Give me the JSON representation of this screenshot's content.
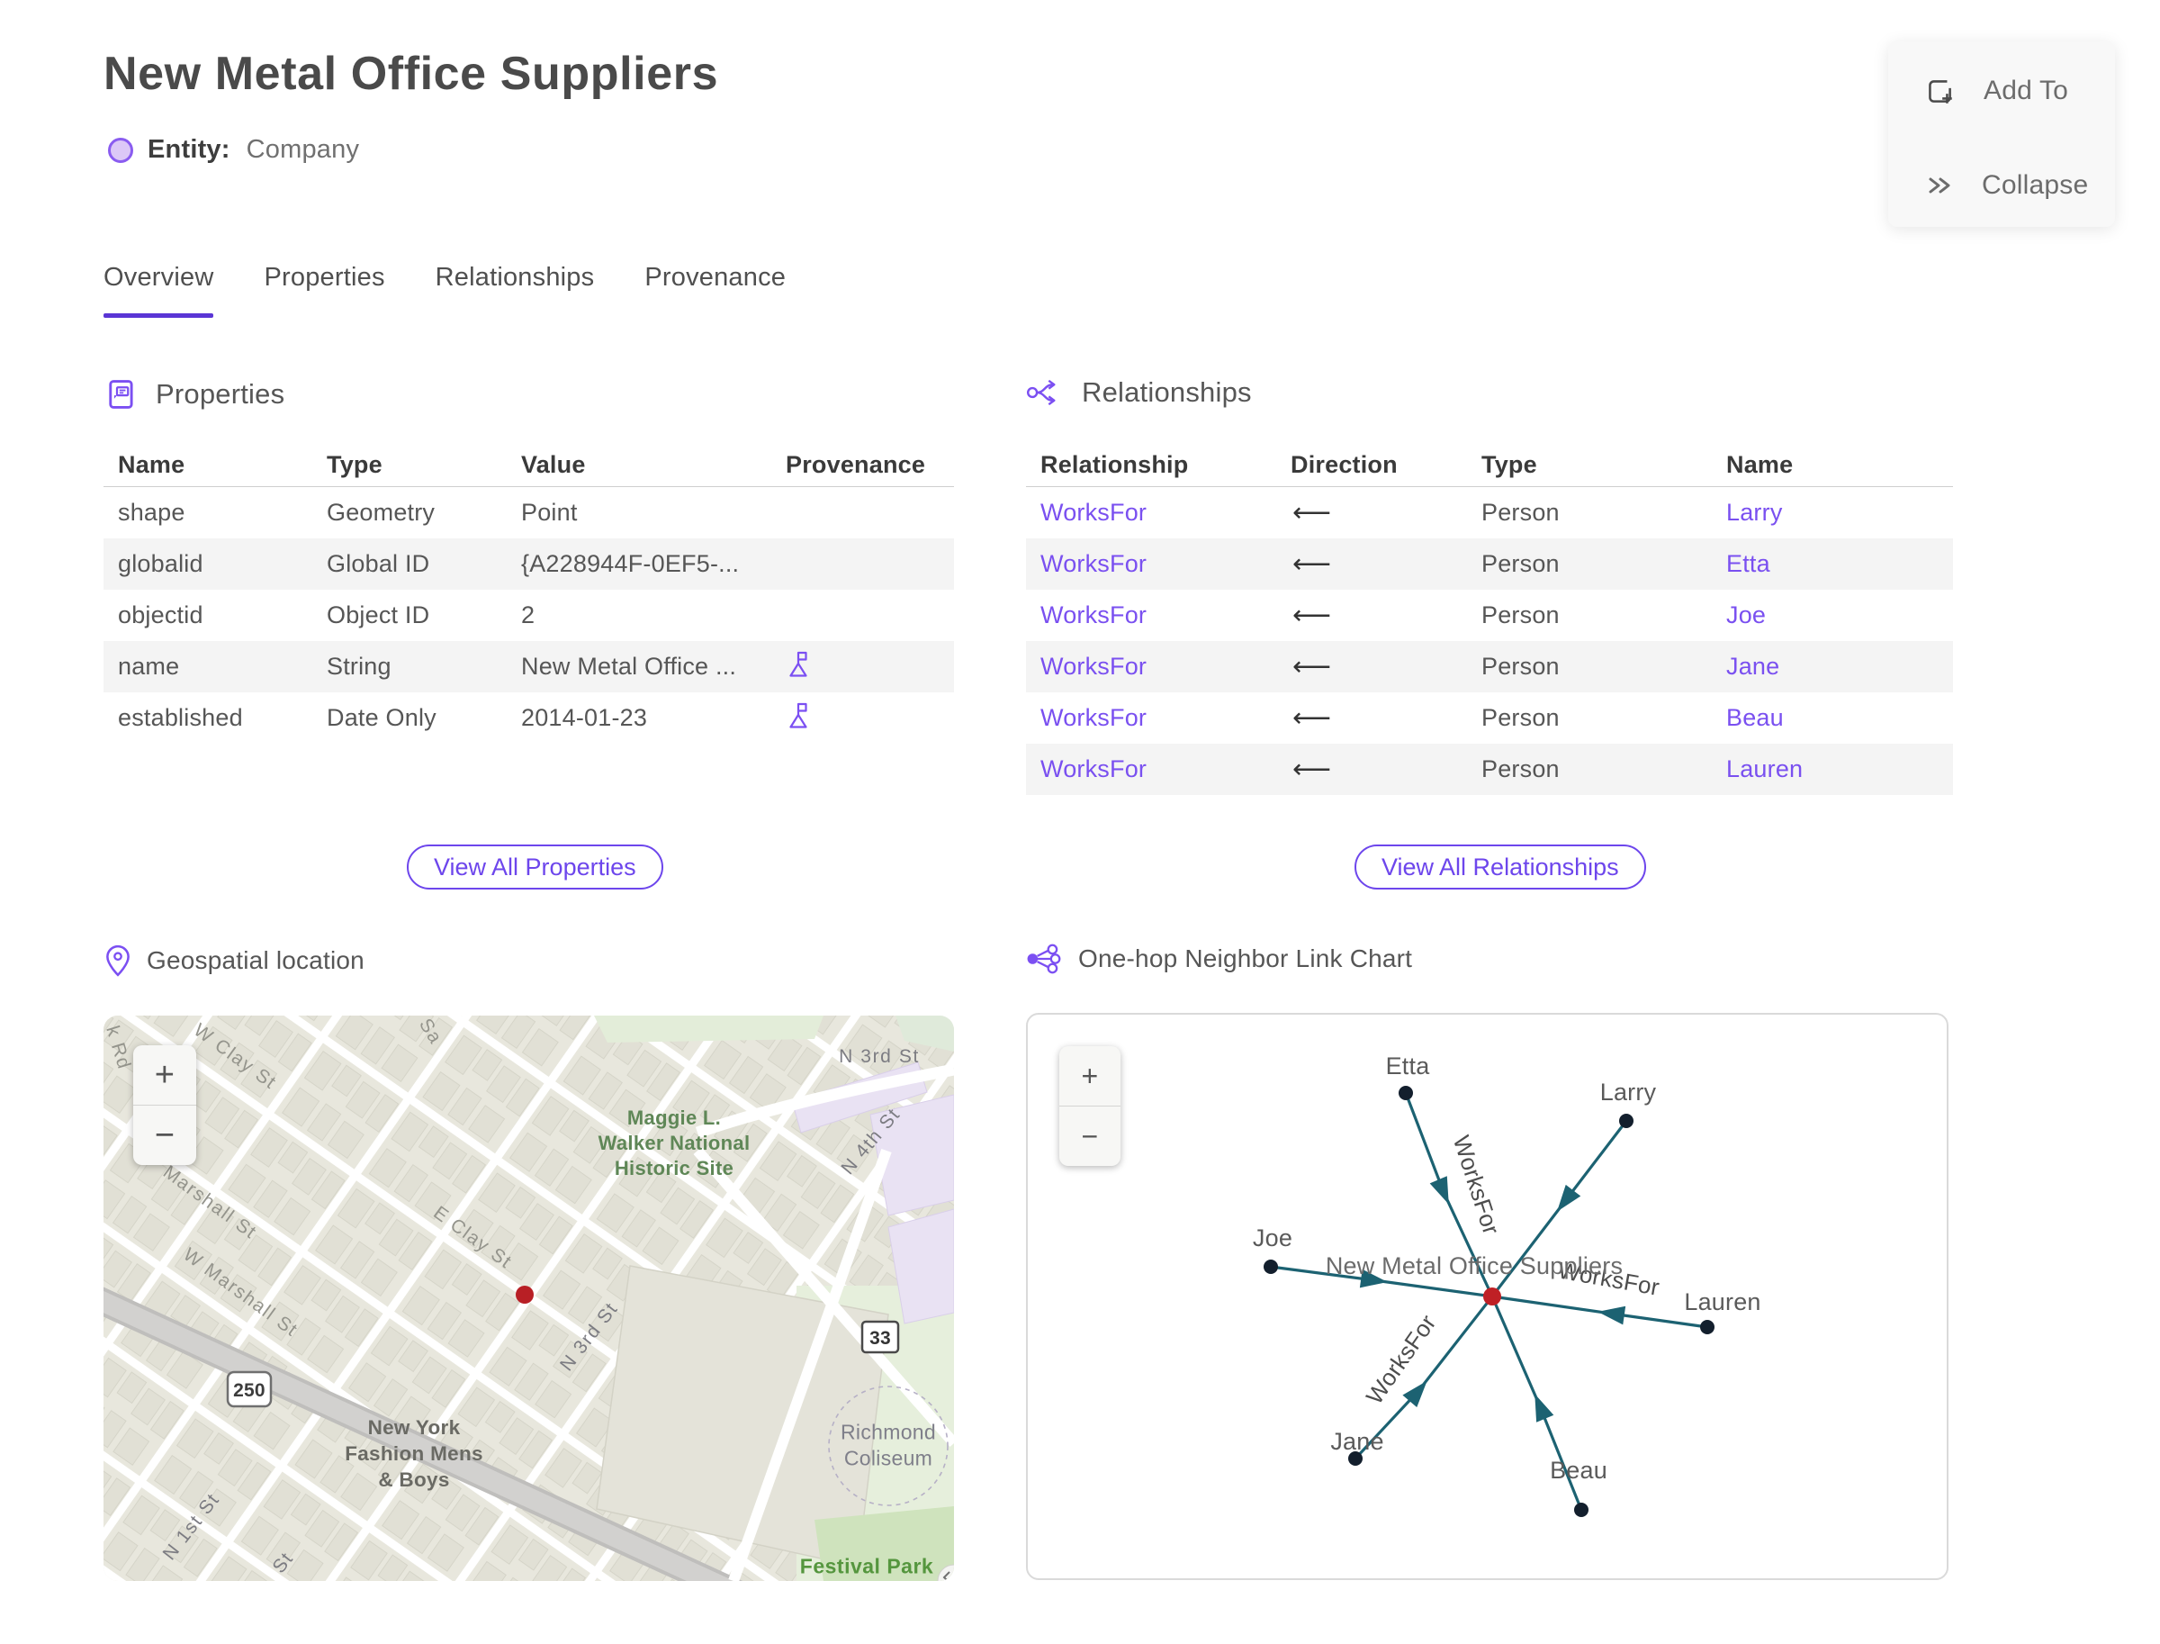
{
  "header": {
    "title": "New Metal Office Suppliers",
    "entity_label": "Entity:",
    "entity_type": "Company"
  },
  "actions": {
    "add_to": "Add To",
    "collapse": "Collapse"
  },
  "tabs": [
    {
      "label": "Overview",
      "active": true
    },
    {
      "label": "Properties",
      "active": false
    },
    {
      "label": "Relationships",
      "active": false
    },
    {
      "label": "Provenance",
      "active": false
    }
  ],
  "properties_section": {
    "title": "Properties",
    "columns": {
      "name": "Name",
      "type": "Type",
      "value": "Value",
      "provenance": "Provenance"
    },
    "rows": [
      {
        "name": "shape",
        "type": "Geometry",
        "value": "Point",
        "provenance": false
      },
      {
        "name": "globalid",
        "type": "Global ID",
        "value": "{A228944F-0EF5-...",
        "provenance": false
      },
      {
        "name": "objectid",
        "type": "Object ID",
        "value": "2",
        "provenance": false
      },
      {
        "name": "name",
        "type": "String",
        "value": "New Metal Office ...",
        "provenance": true
      },
      {
        "name": "established",
        "type": "Date Only",
        "value": "2014-01-23",
        "provenance": true
      }
    ],
    "view_all": "View All Properties"
  },
  "relationships_section": {
    "title": "Relationships",
    "columns": {
      "relationship": "Relationship",
      "direction": "Direction",
      "type": "Type",
      "name": "Name"
    },
    "rows": [
      {
        "relationship": "WorksFor",
        "direction": "⟵",
        "type": "Person",
        "name": "Larry"
      },
      {
        "relationship": "WorksFor",
        "direction": "⟵",
        "type": "Person",
        "name": "Etta"
      },
      {
        "relationship": "WorksFor",
        "direction": "⟵",
        "type": "Person",
        "name": "Joe"
      },
      {
        "relationship": "WorksFor",
        "direction": "⟵",
        "type": "Person",
        "name": "Jane"
      },
      {
        "relationship": "WorksFor",
        "direction": "⟵",
        "type": "Person",
        "name": "Beau"
      },
      {
        "relationship": "WorksFor",
        "direction": "⟵",
        "type": "Person",
        "name": "Lauren"
      }
    ],
    "view_all": "View All Relationships"
  },
  "map_section": {
    "title": "Geospatial location",
    "zoom_in": "+",
    "zoom_out": "−",
    "shields": {
      "us_250": "250",
      "route_33": "33"
    },
    "labels": {
      "k_rd": "k Rd",
      "w_clay": "W Clay St",
      "sa": "Sa",
      "marshall": "Marshall St",
      "w_marshall": "W Marshall St",
      "e_clay": "E Clay St",
      "n_3rd_top": "N 3rd St",
      "n_4th": "N 4th St",
      "maggie": "Maggie L.\nWalker National\nHistoric Site",
      "new_york_fashion": "New York\nFashion Mens\n& Boys",
      "n_1st": "N 1st St",
      "n_3rd_diag": "N 3rd St",
      "st_partial": "St",
      "richmond": "Richmond\nColiseum",
      "festival_park": "Festival Park"
    }
  },
  "chart_section": {
    "title": "One-hop Neighbor Link Chart",
    "zoom_in": "+",
    "zoom_out": "−",
    "center_node": {
      "label": "New Metal Office Suppliers"
    },
    "edge_label": "WorksFor",
    "nodes": [
      {
        "label": "Etta"
      },
      {
        "label": "Larry"
      },
      {
        "label": "Joe"
      },
      {
        "label": "Lauren"
      },
      {
        "label": "Jane"
      },
      {
        "label": "Beau"
      }
    ]
  },
  "colors": {
    "accent_purple": "#7b4ff2",
    "link_purple": "#7a50f0",
    "tab_underline": "#5a35d5",
    "edge_teal": "#1c6272",
    "node_dark": "#131f2d",
    "center_red": "#bf2025",
    "row_stripe": "#f4f4f4",
    "marker_red": "#b81f25"
  }
}
